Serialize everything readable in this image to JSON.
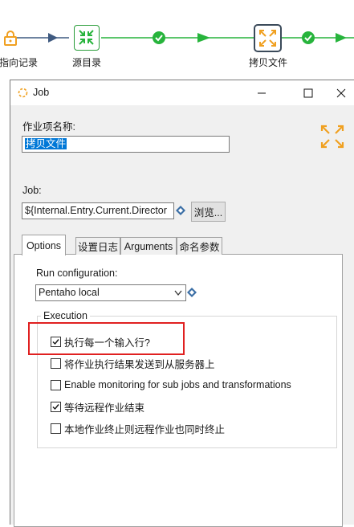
{
  "canvas": {
    "nodes": [
      {
        "label": "指向记录"
      },
      {
        "label": "源目录"
      },
      {
        "label": "拷贝文件"
      }
    ]
  },
  "dialog": {
    "title": "Job",
    "entry_name_label": "作业项名称:",
    "entry_name_value": "拷贝文件",
    "job_label": "Job:",
    "job_value": "${Internal.Entry.Current.Director",
    "browse_label": "浏览...",
    "tabs": [
      {
        "label": "Options",
        "active": true
      },
      {
        "label": "设置日志",
        "active": false
      },
      {
        "label": "Arguments",
        "active": false
      },
      {
        "label": "命名参数",
        "active": false
      }
    ],
    "run_config_label": "Run configuration:",
    "run_config_value": "Pentaho local",
    "execution_group_label": "Execution",
    "options": [
      {
        "label": "执行每一个输入行?",
        "checked": true
      },
      {
        "label": "将作业执行结果发送到从服务器上",
        "checked": false
      },
      {
        "label": "Enable monitoring for sub jobs and transformations",
        "checked": false
      },
      {
        "label": "等待远程作业结束",
        "checked": true
      },
      {
        "label": "本地作业终止则远程作业也同时终止",
        "checked": false
      }
    ]
  },
  "colors": {
    "hop_green": "#27b43c",
    "node_border": "#2a9d3a",
    "node_selected_border": "#3b4a5a",
    "icon_orange": "#f0a020",
    "selection_blue": "#0078d7",
    "highlight_red": "#e02020"
  }
}
